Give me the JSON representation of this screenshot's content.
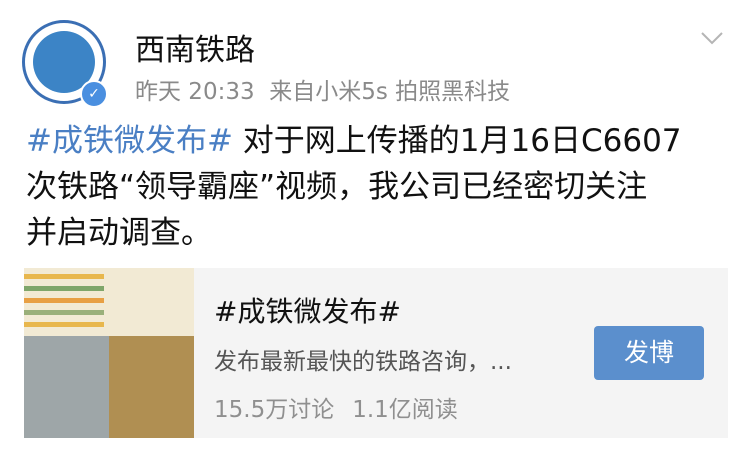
{
  "post": {
    "user_name": "西南铁路",
    "timestamp": "昨天 20:33",
    "source": "来自小米5s 拍照黑科技",
    "topic_tag": "#成铁微发布#",
    "text_line1": " 对于网上传播的1月16日C6607",
    "text_line2": "次铁路“领导霸座”视频，我公司已经密切关注",
    "text_line3": "并启动调查。"
  },
  "topic_card": {
    "title": "#成铁微发布#",
    "description": "发布最新最快的铁路咨询，...",
    "discussions": "15.5万讨论",
    "reads": "1.1亿阅读",
    "button_label": "发博"
  },
  "colors": {
    "topic_link": "#4a7fc4",
    "button_bg": "#5b8fcd",
    "verified_badge": "#4a8fe0"
  }
}
